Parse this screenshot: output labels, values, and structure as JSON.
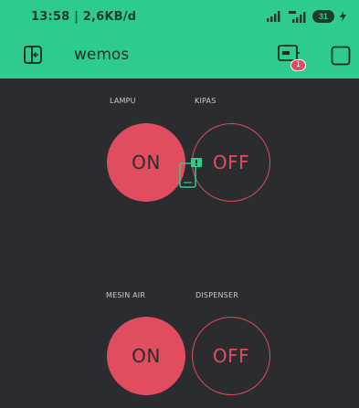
{
  "status_bar": {
    "time_speed": "13:58 | 2,6KB/d",
    "battery": "31"
  },
  "app_bar": {
    "project_name": "wemos",
    "notification_count": "1"
  },
  "widgets": [
    {
      "label": "LAMPU",
      "state": "ON"
    },
    {
      "label": "KIPAS",
      "state": "OFF"
    },
    {
      "label": "MESIN AIR",
      "state": "ON"
    },
    {
      "label": "DISPENSER",
      "state": "OFF"
    }
  ],
  "colors": {
    "accent": "#2ecc8c",
    "button": "#e04d5f",
    "background": "#2b2c30"
  },
  "icons": {
    "back": "exit-icon",
    "device": "device-icon",
    "widget_box": "square-icon",
    "phone_notice": "phone-notice-icon"
  }
}
